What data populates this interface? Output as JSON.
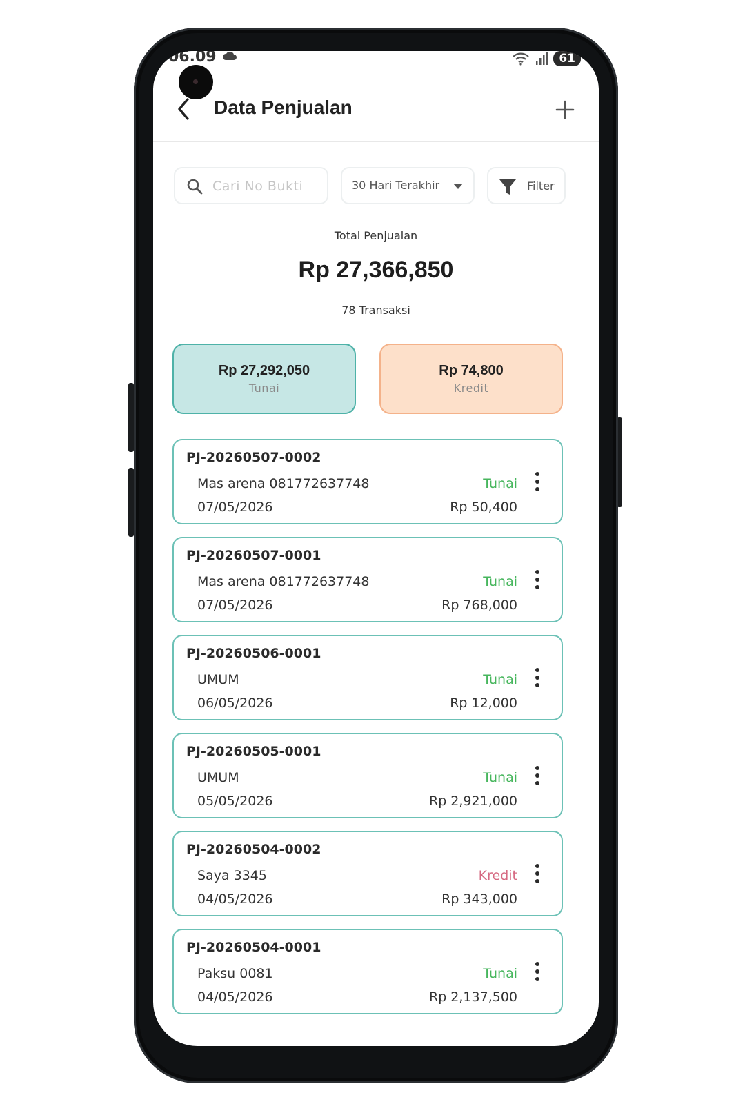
{
  "status_bar": {
    "time": "06.09",
    "battery": "61"
  },
  "appbar": {
    "title": "Data Penjualan"
  },
  "toolbar": {
    "search_placeholder": "Cari No Bukti",
    "period_selected": "30 Hari Terakhir",
    "filter_label": "Filter"
  },
  "summary": {
    "label": "Total Penjualan",
    "total": "Rp 27,366,850",
    "count": "78 Transaksi"
  },
  "payment_cards": {
    "cash": {
      "amount": "Rp 27,292,050",
      "label": "Tunai"
    },
    "credit": {
      "amount": "Rp 74,800",
      "label": "Kredit"
    }
  },
  "transactions": [
    {
      "no": "PJ-20260507-0002",
      "customer": "Mas arena 081772637748",
      "date": "07/05/2026",
      "method": "Tunai",
      "amount": "Rp 50,400"
    },
    {
      "no": "PJ-20260507-0001",
      "customer": "Mas arena 081772637748",
      "date": "07/05/2026",
      "method": "Tunai",
      "amount": "Rp 768,000"
    },
    {
      "no": "PJ-20260506-0001",
      "customer": "UMUM",
      "date": "06/05/2026",
      "method": "Tunai",
      "amount": "Rp 12,000"
    },
    {
      "no": "PJ-20260505-0001",
      "customer": "UMUM",
      "date": "05/05/2026",
      "method": "Tunai",
      "amount": "Rp 2,921,000"
    },
    {
      "no": "PJ-20260504-0002",
      "customer": "Saya 3345",
      "date": "04/05/2026",
      "method": "Kredit",
      "amount": "Rp 343,000"
    },
    {
      "no": "PJ-20260504-0001",
      "customer": "Paksu 0081",
      "date": "04/05/2026",
      "method": "Tunai",
      "amount": "Rp 2,137,500"
    }
  ],
  "colors": {
    "accent": "#4eb2a8",
    "cash_bg": "#c6e7e5",
    "credit_bg": "#fde0ca",
    "tunai_text": "#47b65d",
    "kredit_text": "#d66a82"
  },
  "icons": [
    "back-arrow-icon",
    "plus-icon",
    "search-icon",
    "caret-down-icon",
    "filter-funnel-icon",
    "more-vertical-icon",
    "cloud-icon",
    "wifi-icon",
    "signal-icon"
  ]
}
